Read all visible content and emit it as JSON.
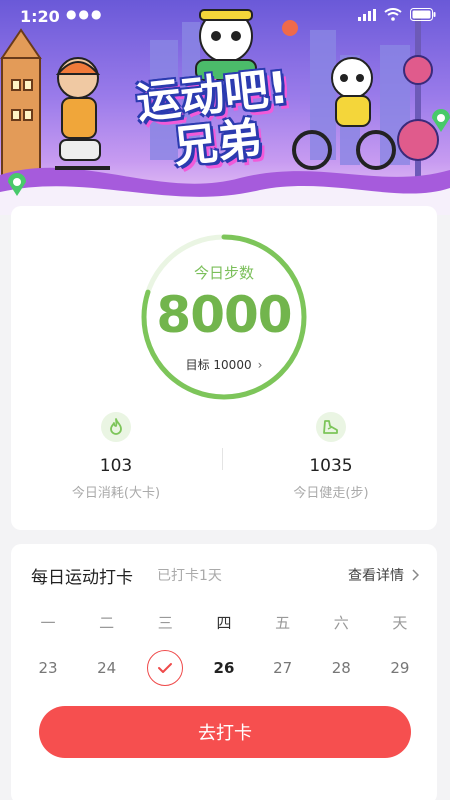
{
  "status": {
    "time": "1:20",
    "signal_dots": "●●●"
  },
  "banner": {
    "title_line1": "运动吧!",
    "title_line2": "兄弟"
  },
  "steps": {
    "label": "今日步数",
    "value": "8000",
    "goal_label": "目标 10000",
    "progress": 0.8,
    "ring_color": "#7dc55a",
    "track_color": "#eaf5e3"
  },
  "stats": [
    {
      "icon": "flame-icon",
      "value": "103",
      "label": "今日消耗(大卡)"
    },
    {
      "icon": "shoe-icon",
      "value": "1035",
      "label": "今日健走(步)"
    }
  ],
  "checkin": {
    "title": "每日运动打卡",
    "subtitle": "已打卡1天",
    "more_label": "查看详情",
    "weekdays": [
      "一",
      "二",
      "三",
      "四",
      "五",
      "六",
      "天"
    ],
    "dates": [
      "23",
      "24",
      "25",
      "26",
      "27",
      "28",
      "29"
    ],
    "checked_index": 2,
    "today_index": 3,
    "button_label": "去打卡",
    "accent": "#f64f4f"
  }
}
